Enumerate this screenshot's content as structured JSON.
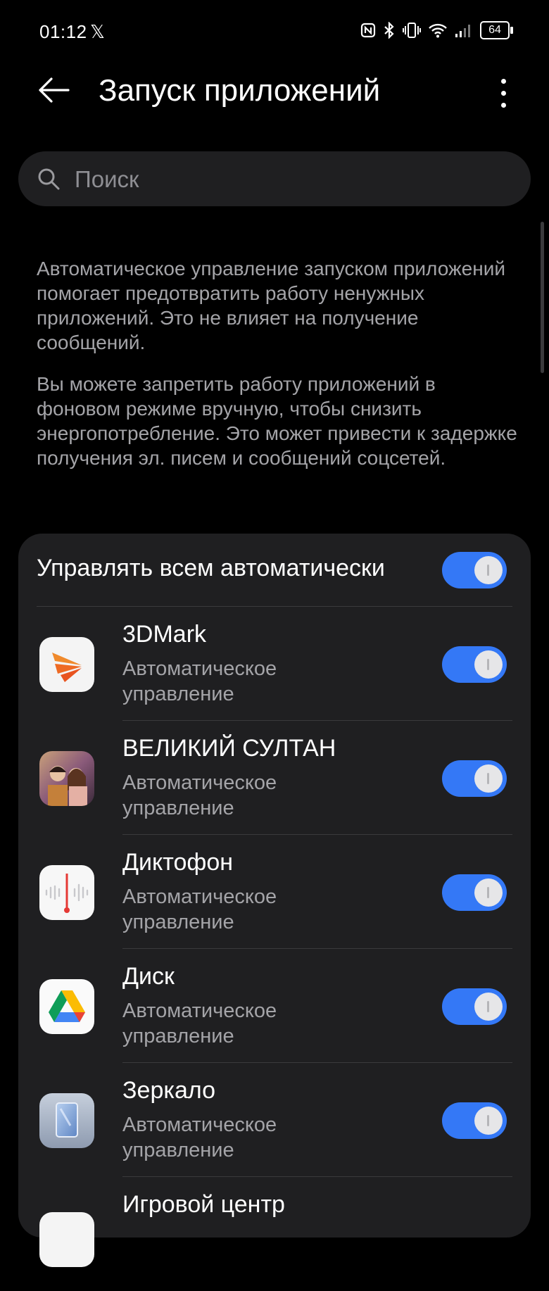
{
  "status_bar": {
    "time": "01:12",
    "x_glyph": "𝕏",
    "battery": "64"
  },
  "header": {
    "title": "Запуск приложений"
  },
  "search": {
    "placeholder": "Поиск"
  },
  "description": {
    "p1": "Автоматическое управление запуском приложений помогает предотвратить работу ненужных приложений. Это не влияет на получение сообщений.",
    "p2": "Вы можете запретить работу приложений в фоновом режиме вручную, чтобы снизить энергопотребление. Это может привести к задержке получения эл. писем и сообщений соцсетей."
  },
  "master_toggle": {
    "label": "Управлять всем автоматически",
    "on": true
  },
  "apps": [
    {
      "name": "3DMark",
      "status": "Автоматическое управление",
      "icon": "3dmark-icon",
      "on": true
    },
    {
      "name": "ВЕЛИКИЙ СУЛТАН",
      "status": "Автоматическое управление",
      "icon": "great-sultan-icon",
      "on": true
    },
    {
      "name": "Диктофон",
      "status": "Автоматическое управление",
      "icon": "voice-recorder-icon",
      "on": true
    },
    {
      "name": "Диск",
      "status": "Автоматическое управление",
      "icon": "google-drive-icon",
      "on": true
    },
    {
      "name": "Зеркало",
      "status": "Автоматическое управление",
      "icon": "mirror-icon",
      "on": true
    },
    {
      "name": "Игровой центр",
      "status": "",
      "icon": "game-center-icon",
      "on": true
    }
  ],
  "colors": {
    "accent": "#3478f6",
    "background": "#000000",
    "card": "#1f1f21"
  }
}
